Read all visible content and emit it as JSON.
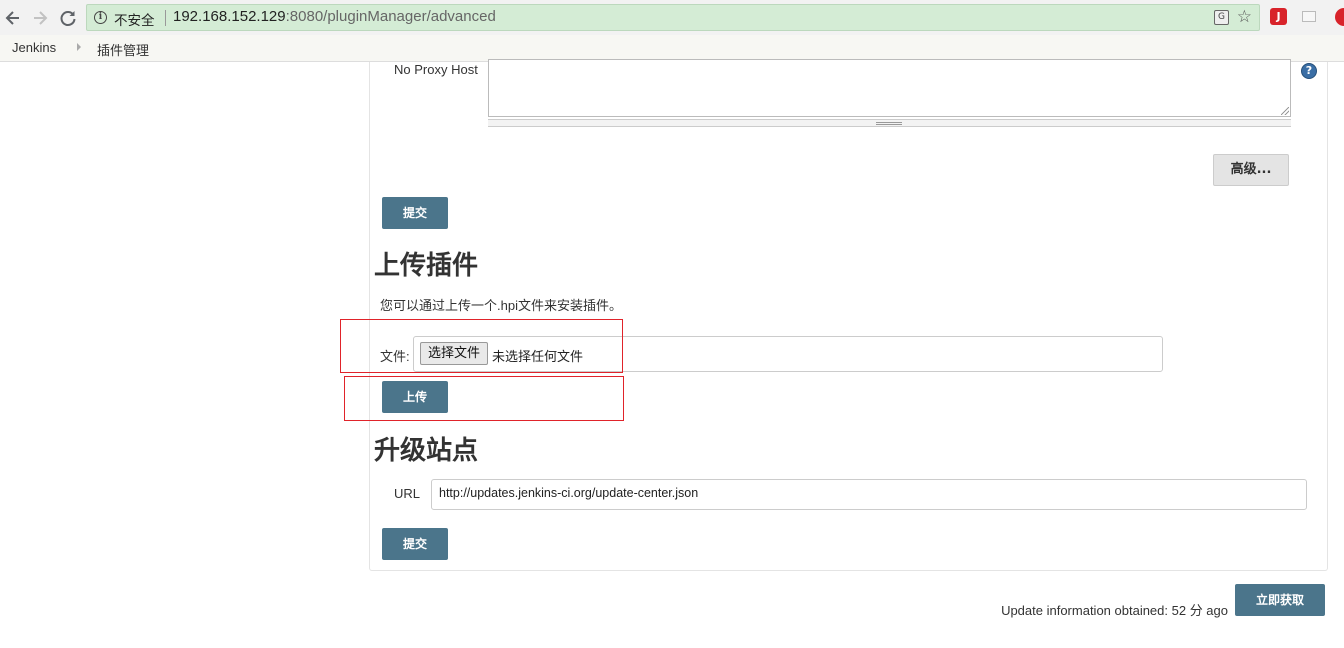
{
  "browser": {
    "security_label": "不安全",
    "url_host": "192.168.152.129",
    "url_path": ":8080/pluginManager/advanced",
    "info_icon_glyph": "i",
    "translate_icon_glyph": "G",
    "ext1_glyph": "J",
    "icons": [
      "back-arrow-icon",
      "forward-arrow-icon",
      "reload-icon",
      "info-icon",
      "translate-icon",
      "star-icon"
    ]
  },
  "breadcrumb": {
    "home": "Jenkins",
    "current": "插件管理"
  },
  "proxy": {
    "no_proxy_label": "No Proxy Host",
    "advanced_button": "高级...",
    "submit_button": "提交",
    "help_glyph": "?"
  },
  "upload": {
    "title": "上传插件",
    "description": "您可以通过上传一个.hpi文件来安装插件。",
    "file_label": "文件:",
    "choose_file_button": "选择文件",
    "no_file_text": "未选择任何文件",
    "upload_button": "上传"
  },
  "update_site": {
    "title": "升级站点",
    "url_label": "URL",
    "url_value": "http://updates.jenkins-ci.org/update-center.json",
    "submit_button": "提交"
  },
  "footer": {
    "update_info": "Update information obtained: 52 分 ago",
    "fetch_now_button": "立即获取"
  },
  "colors": {
    "primary_button": "#4b758b",
    "annotation_red": "#e0232a",
    "omnibox_green": "#d4ecd5"
  }
}
